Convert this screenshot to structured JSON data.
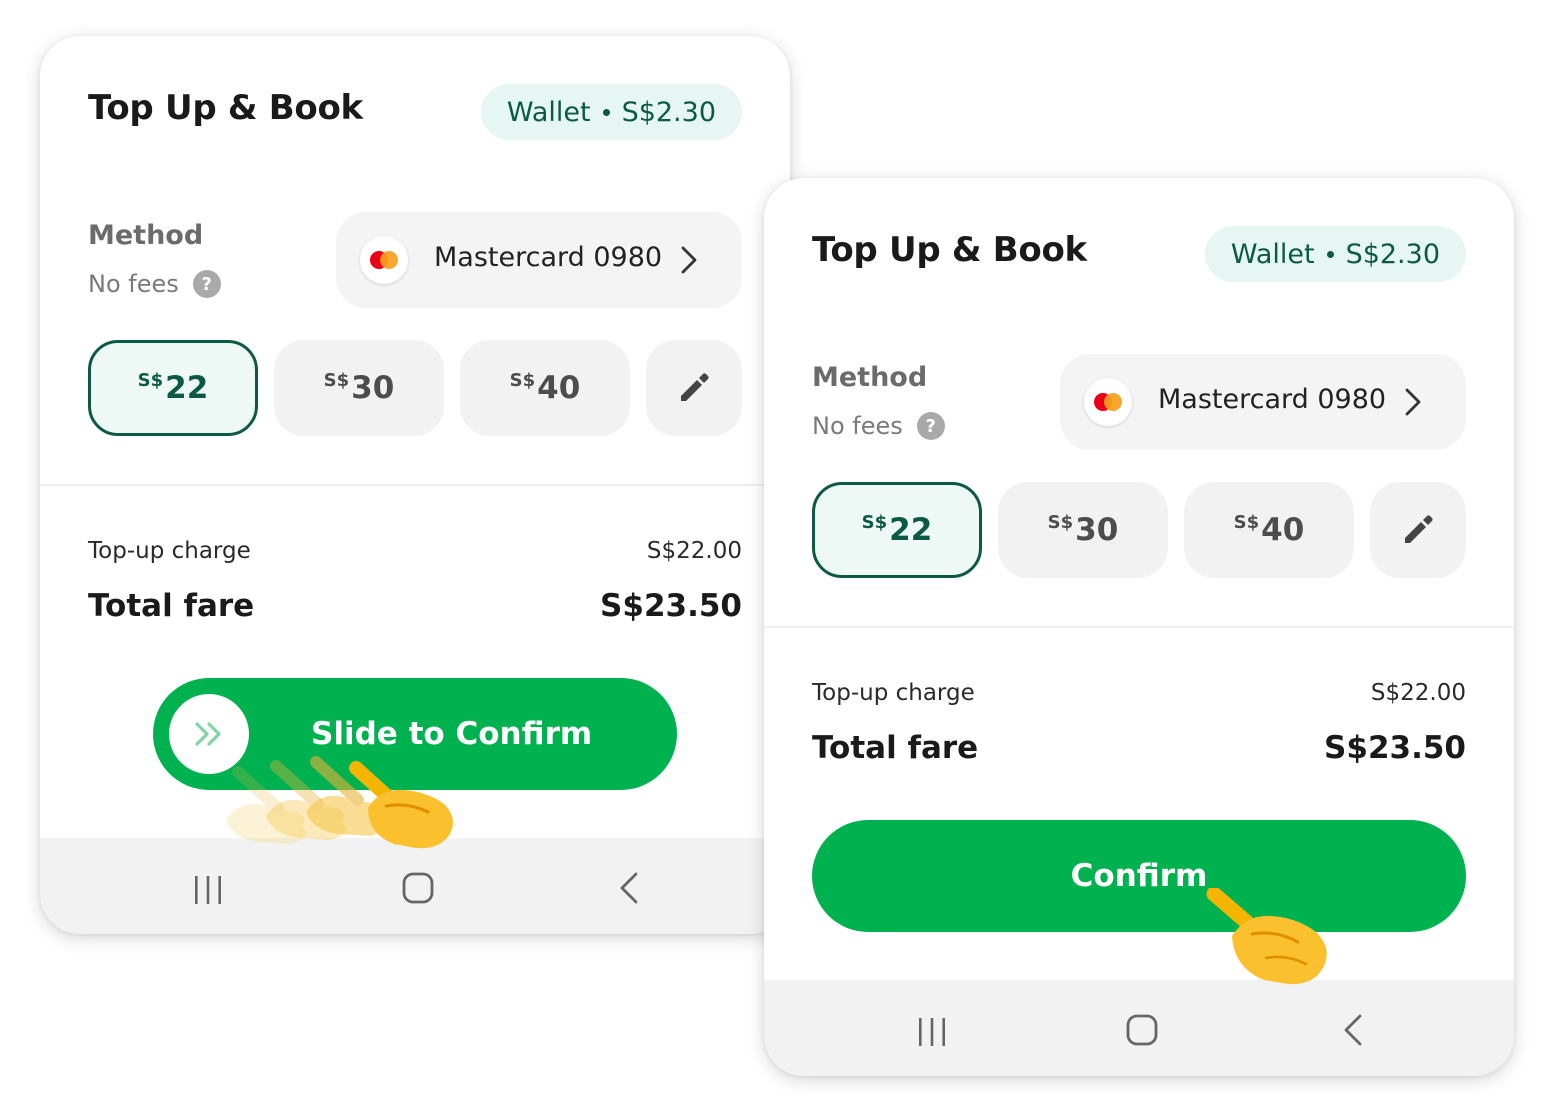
{
  "screens": [
    {
      "title": "Top Up & Book",
      "wallet_label": "Wallet",
      "wallet_balance": "S$2.30",
      "method_label": "Method",
      "fees_label": "No fees",
      "method_card": "Mastercard 0980",
      "amounts": [
        {
          "currency": "S$",
          "value": "22",
          "selected": true
        },
        {
          "currency": "S$",
          "value": "30",
          "selected": false
        },
        {
          "currency": "S$",
          "value": "40",
          "selected": false
        }
      ],
      "topup_charge_label": "Top-up charge",
      "topup_charge_value": "S$22.00",
      "total_fare_label": "Total fare",
      "total_fare_value": "S$23.50",
      "action_label": "Slide to Confirm"
    },
    {
      "title": "Top Up & Book",
      "wallet_label": "Wallet",
      "wallet_balance": "S$2.30",
      "method_label": "Method",
      "fees_label": "No fees",
      "method_card": "Mastercard 0980",
      "amounts": [
        {
          "currency": "S$",
          "value": "22",
          "selected": true
        },
        {
          "currency": "S$",
          "value": "30",
          "selected": false
        },
        {
          "currency": "S$",
          "value": "40",
          "selected": false
        }
      ],
      "topup_charge_label": "Top-up charge",
      "topup_charge_value": "S$22.00",
      "total_fare_label": "Total fare",
      "total_fare_value": "S$23.50",
      "action_label": "Confirm"
    }
  ],
  "colors": {
    "brand_green": "#00b14f",
    "selected_border": "#0d5a44",
    "wallet_bg": "#e6f6f2",
    "wallet_text": "#0b5a43"
  },
  "icons": [
    "help-icon",
    "mastercard-icon",
    "chevron-right-icon",
    "pencil-icon",
    "double-chevron-right-icon",
    "recents-icon",
    "home-icon",
    "back-icon",
    "pointing-hand-icon"
  ]
}
